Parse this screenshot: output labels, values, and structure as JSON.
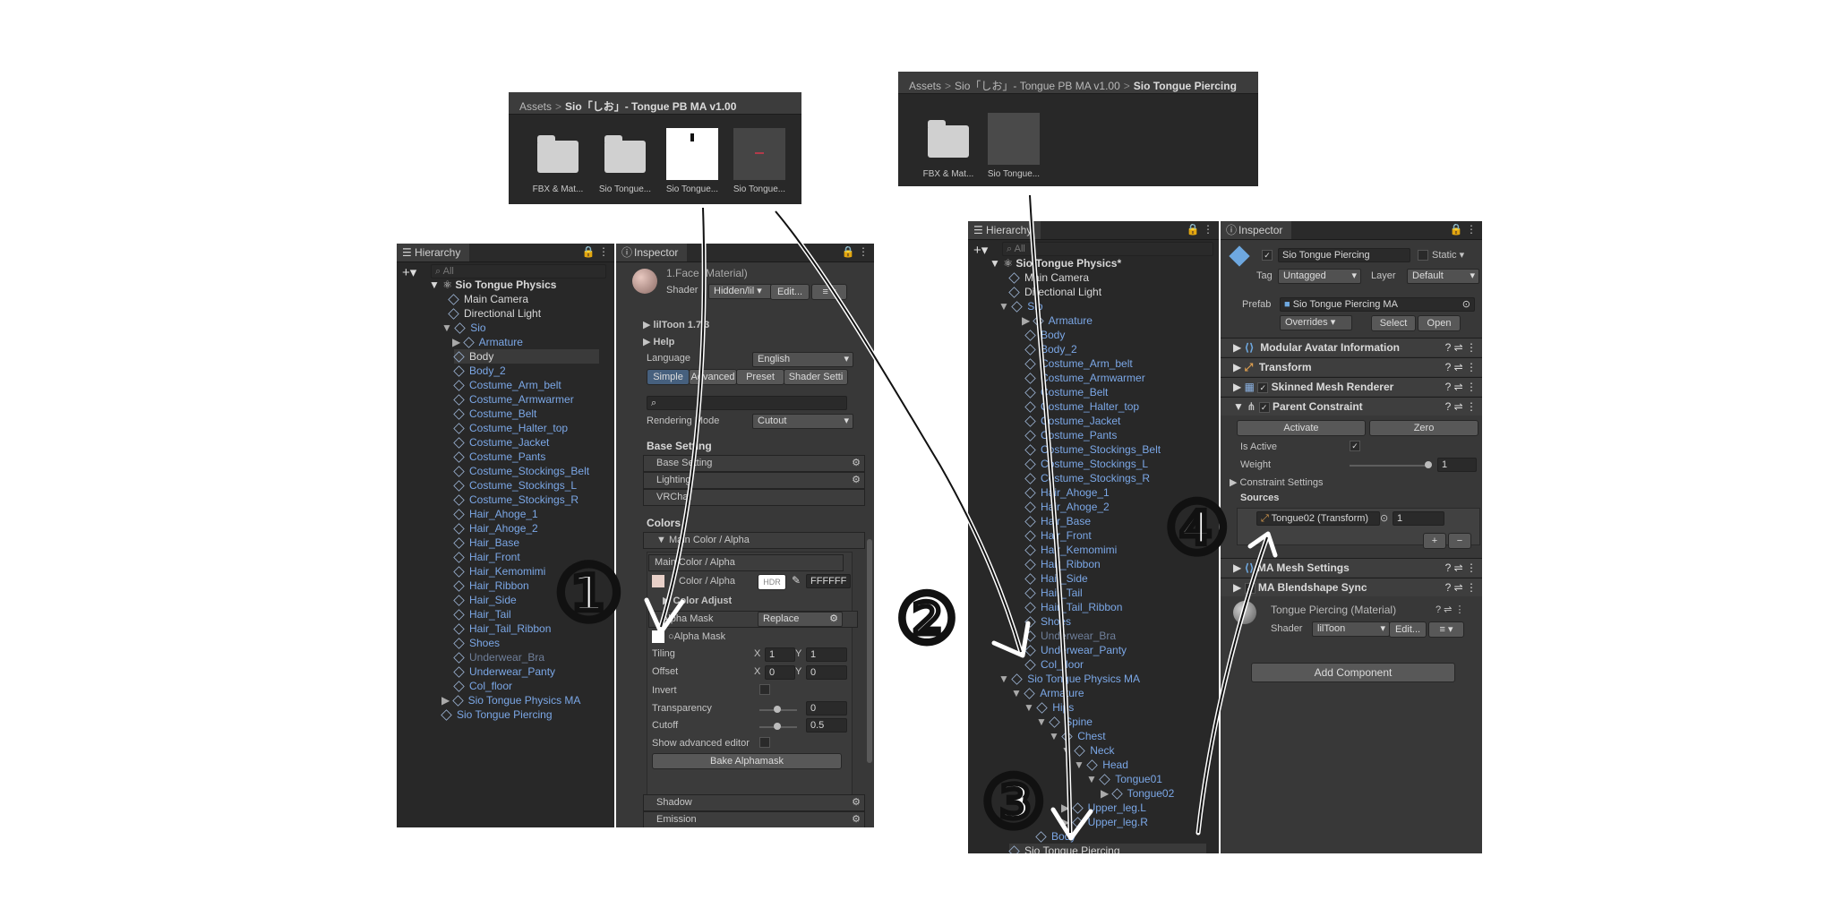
{
  "project1": {
    "breadcrumb": [
      "Assets",
      "Sio「しお」- Tongue PB MA v1.00"
    ],
    "assets": [
      "FBX & Mat...",
      "Sio Tongue...",
      "Sio Tongue...",
      "Sio Tongue..."
    ]
  },
  "project2": {
    "breadcrumb": [
      "Assets",
      "Sio「しお」- Tongue PB MA v1.00",
      "Sio Tongue Piercing"
    ],
    "assets": [
      "FBX & Mat...",
      "Sio Tongue..."
    ]
  },
  "hierarchy1": {
    "tab": "Hierarchy",
    "search_placeholder": "All",
    "scene": "Sio Tongue Physics",
    "items": [
      "Main Camera",
      "Directional Light",
      "Sio",
      "Armature",
      "Body",
      "Body_2",
      "Costume_Arm_belt",
      "Costume_Armwarmer",
      "Costume_Belt",
      "Costume_Halter_top",
      "Costume_Jacket",
      "Costume_Pants",
      "Costume_Stockings_Belt",
      "Costume_Stockings_L",
      "Costume_Stockings_R",
      "Hair_Ahoge_1",
      "Hair_Ahoge_2",
      "Hair_Base",
      "Hair_Front",
      "Hair_Kemomimi",
      "Hair_Ribbon",
      "Hair_Side",
      "Hair_Tail",
      "Hair_Tail_Ribbon",
      "Shoes",
      "Underwear_Bra",
      "Underwear_Panty",
      "Col_floor",
      "Sio Tongue Physics MA",
      "Sio Tongue Piercing"
    ]
  },
  "inspector1": {
    "tab": "Inspector",
    "material_title": "1.Face (Material)",
    "shader_label": "Shader",
    "shader_value": "Hidden/lil",
    "edit_label": "Edit...",
    "liltoon_version": "lilToon 1.7.3",
    "help": "Help",
    "language_label": "Language",
    "language_value": "English",
    "modes": [
      "Simple",
      "Advanced",
      "Preset",
      "Shader Setti"
    ],
    "rendering_mode_label": "Rendering Mode",
    "rendering_mode_value": "Cutout",
    "base_setting_header": "Base Setting",
    "folds": [
      "Base Setting",
      "Lighting",
      "VRChat"
    ],
    "color_header": "Colors",
    "main_color_fold": "Main Color / Alpha",
    "main_color_box": "Main Color / Alpha",
    "color_alpha_label": "Color / Alpha",
    "hdr": "HDR",
    "hex": "FFFFFF",
    "color_adjust": "Color Adjust",
    "alpha_mask_fold": "Alpha Mask",
    "replace_value": "Replace",
    "alpha_mask_label": "Alpha Mask",
    "tiling_label": "Tiling",
    "offset_label": "Offset",
    "tiling_x": "1",
    "tiling_y": "1",
    "offset_x": "0",
    "offset_y": "0",
    "x_label": "X",
    "y_label": "Y",
    "invert_label": "Invert",
    "transparency_label": "Transparency",
    "transparency_value": "0",
    "cutoff_label": "Cutoff",
    "cutoff_value": "0.5",
    "show_advanced": "Show advanced editor",
    "bake_button": "Bake Alphamask",
    "shadow_fold": "Shadow",
    "emission_fold": "Emission"
  },
  "hierarchy2": {
    "tab": "Hierarchy",
    "search_placeholder": "All",
    "scene": "Sio Tongue Physics*",
    "items": [
      "Main Camera",
      "Directional Light",
      "Sio",
      "Armature",
      "Body",
      "Body_2",
      "Costume_Arm_belt",
      "Costume_Armwarmer",
      "Costume_Belt",
      "Costume_Halter_top",
      "Costume_Jacket",
      "Costume_Pants",
      "Costume_Stockings_Belt",
      "Costume_Stockings_L",
      "Costume_Stockings_R",
      "Hair_Ahoge_1",
      "Hair_Ahoge_2",
      "Hair_Base",
      "Hair_Front",
      "Hair_Kemomimi",
      "Hair_Ribbon",
      "Hair_Side",
      "Hair_Tail",
      "Hair_Tail_Ribbon",
      "Shoes",
      "Underwear_Bra",
      "Underwear_Panty",
      "Col_floor",
      "Sio Tongue Physics MA",
      "Armature",
      "Hips",
      "Spine",
      "Chest",
      "Neck",
      "Head",
      "Tongue01",
      "Tongue02",
      "Upper_leg.L",
      "Upper_leg.R",
      "Body",
      "Sio Tongue Piercing"
    ]
  },
  "inspector2": {
    "tab": "Inspector",
    "object_name": "Sio Tongue Piercing",
    "static_label": "Static",
    "tag_label": "Tag",
    "tag_value": "Untagged",
    "layer_label": "Layer",
    "layer_value": "Default",
    "prefab_label": "Prefab",
    "prefab_value": "Sio Tongue Piercing MA",
    "overrides": "Overrides",
    "select": "Select",
    "open": "Open",
    "components": [
      "Modular Avatar Information",
      "Transform",
      "Skinned Mesh Renderer",
      "Parent Constraint"
    ],
    "activate": "Activate",
    "zero": "Zero",
    "is_active_label": "Is Active",
    "weight_label": "Weight",
    "weight_value": "1",
    "constraint_settings": "Constraint Settings",
    "sources_label": "Sources",
    "source_item": "Tongue02 (Transform)",
    "source_weight": "1",
    "plus": "+",
    "minus": "−",
    "ma_mesh_settings": "MA Mesh Settings",
    "ma_blendshape_sync": "MA Blendshape Sync",
    "material_title": "Tongue Piercing (Material)",
    "shader_label": "Shader",
    "shader_value": "lilToon",
    "edit_label": "Edit...",
    "add_component": "Add Component"
  },
  "annotations": [
    "①",
    "②",
    "③",
    "④"
  ]
}
